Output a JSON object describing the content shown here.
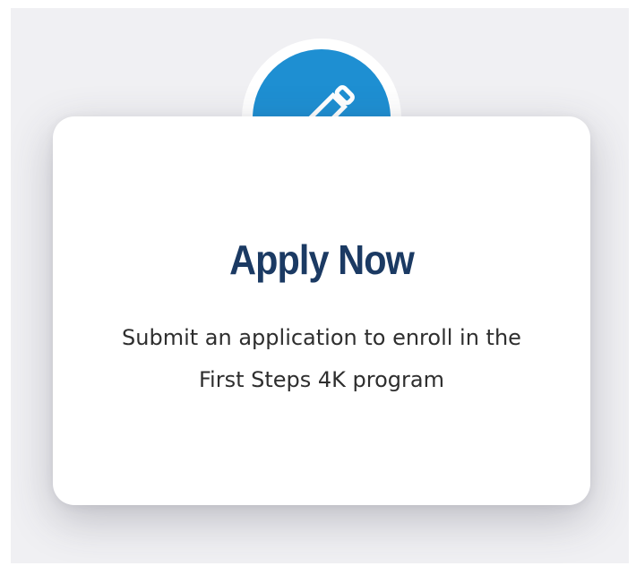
{
  "card": {
    "icon": "pencil-icon",
    "title": "Apply Now",
    "description": "Submit an application to enroll in the First Steps 4K program"
  },
  "colors": {
    "accent": "#1e8fd2",
    "title": "#1b3a63",
    "background": "#f0f0f3"
  }
}
